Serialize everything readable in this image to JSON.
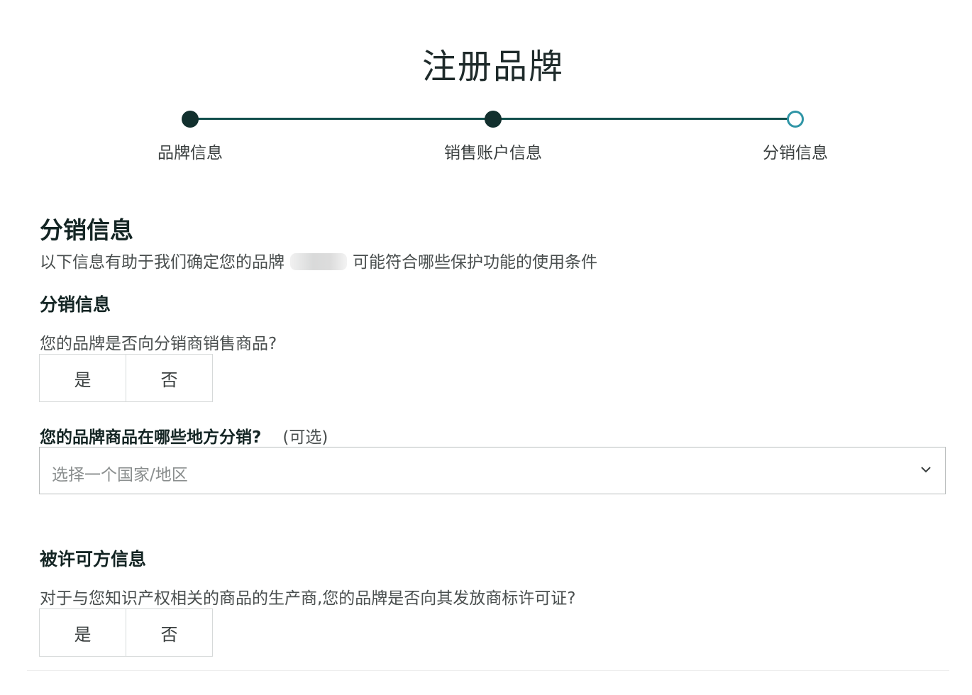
{
  "page": {
    "title": "注册品牌"
  },
  "stepper": {
    "steps": [
      {
        "label": "品牌信息",
        "state": "completed"
      },
      {
        "label": "销售账户信息",
        "state": "completed"
      },
      {
        "label": "分销信息",
        "state": "current"
      }
    ],
    "colors": {
      "line": "#124f4c",
      "completed_dot": "#12302e",
      "current_ring": "#2f95a6"
    }
  },
  "section": {
    "heading": "分销信息",
    "desc_before": "以下信息有助于我们确定您的品牌",
    "desc_after": "可能符合哪些保护功能的使用条件"
  },
  "distribution": {
    "subheading": "分销信息",
    "question": "您的品牌是否向分销商销售商品?",
    "yes_label": "是",
    "no_label": "否",
    "where_label": "您的品牌商品在哪些地方分销?",
    "optional_label": "(可选)",
    "select_placeholder": "选择一个国家/地区",
    "select_icon": "chevron-down-icon"
  },
  "licensee": {
    "subheading": "被许可方信息",
    "question": "对于与您知识产权相关的商品的生产商,您的品牌是否向其发放商标许可证?",
    "yes_label": "是",
    "no_label": "否"
  }
}
